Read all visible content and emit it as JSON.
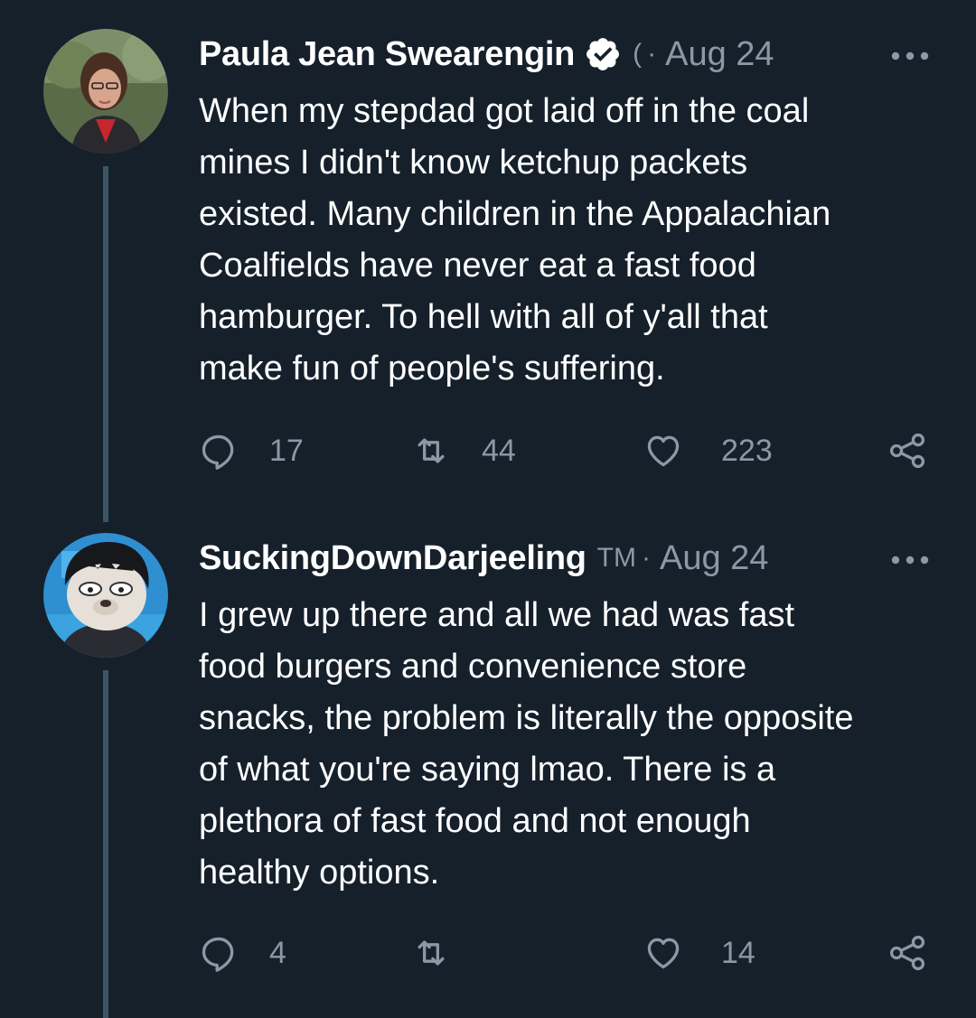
{
  "colors": {
    "background": "#15202b",
    "text_primary": "#ffffff",
    "text_secondary": "#8b98a5",
    "thread_line": "#3d5466"
  },
  "tweets": [
    {
      "author_name": "Paula Jean Swearengin",
      "verified": true,
      "handle": "(",
      "separator": "·",
      "date": "Aug 24",
      "text": "When my stepdad got laid off in the coal\nmines I didn't know ketchup packets\nexisted. Many children in the Appalachian\nCoalfields have never eat a fast food\nhamburger. To hell with all of y'all that\nmake fun of people's suffering.",
      "replies": "17",
      "retweets": "44",
      "likes": "223",
      "icons": [
        "avatar-photo",
        "verified-badge-icon",
        "more-icon",
        "reply-icon",
        "retweet-icon",
        "like-icon",
        "share-icon"
      ]
    },
    {
      "author_name": "SuckingDownDarjeeling",
      "verified": false,
      "handle": "TM",
      "separator": "·",
      "date": "Aug 24",
      "text": "I grew up there and all we had was fast\nfood burgers and convenience store\nsnacks, the problem is literally the opposite\nof what you're saying lmao. There is a\nplethora of fast food and not enough\nhealthy options.",
      "replies": "4",
      "retweets": "",
      "likes": "14",
      "icons": [
        "avatar-photo",
        "more-icon",
        "reply-icon",
        "retweet-icon",
        "like-icon",
        "share-icon"
      ]
    }
  ]
}
